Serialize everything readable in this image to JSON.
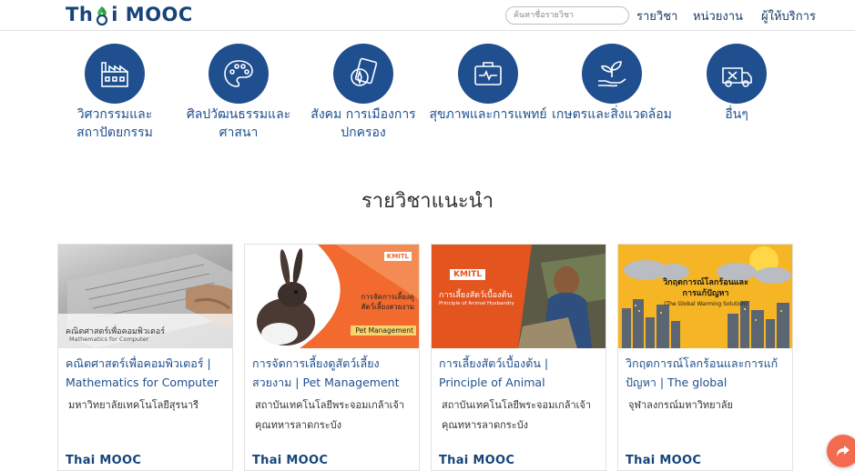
{
  "header": {
    "logo_left": "Th",
    "logo_right": "i MOOC",
    "search_placeholder": "ค้นหาชื่อรายวิชา",
    "nav": [
      "รายวิชา",
      "หน่วยงาน",
      "ผู้ให้บริการ"
    ]
  },
  "categories": [
    {
      "label": "วิศวกรรมและสถาปัตยกรรม",
      "icon": "factory-icon"
    },
    {
      "label": "ศิลปวัฒนธรรมและศาสนา",
      "icon": "palette-icon"
    },
    {
      "label": "สังคม การเมืองการปกครอง",
      "icon": "compass-icon"
    },
    {
      "label": "สุขภาพและการแพทย์",
      "icon": "medical-kit-icon"
    },
    {
      "label": "เกษตรและสิ่งแวดล้อม",
      "icon": "plant-hand-icon"
    },
    {
      "label": "อื่นๆ",
      "icon": "tools-truck-icon"
    }
  ],
  "section_title": "รายวิชาแนะนำ",
  "courses": [
    {
      "title": "คณิตศาสตร์เพื่อคอมพิวเตอร์ | Mathematics for Computer",
      "institution": "มหาวิทยาลัยเทคโนโลยีสุรนารี",
      "thumb_text_th": "คณิตศาสตร์เพื่อคอมพิวเตอร์",
      "thumb_text_en": "Mathematics for Computer"
    },
    {
      "title": "การจัดการเลี้ยงดูสัตว์เลี้ยงสวยงาม | Pet Management",
      "institution": "สถาบันเทคโนโลยีพระจอมเกล้าเจ้าคุณทหารลาดกระบัง",
      "thumb_text_th": "การจัดการเลี้ยงดูสัตว์เลี้ยงสวยงาม",
      "thumb_text_en": "Pet Management",
      "thumb_badge": "KMITL"
    },
    {
      "title": "การเลี้ยงสัตว์เบื้องต้น | Principle of Animal Husbandry",
      "institution": "สถาบันเทคโนโลยีพระจอมเกล้าเจ้าคุณทหารลาดกระบัง",
      "thumb_text_th": "การเลี้ยงสัตว์เบื้องต้น",
      "thumb_text_en": "Principle of Animal Husbandry",
      "thumb_badge": "KMITL"
    },
    {
      "title": "วิกฤตการณ์โลกร้อนและการแก้ปัญหา | The global warming...",
      "institution": "จุฬาลงกรณ์มหาวิทยาลัย",
      "thumb_text_th": "วิกฤตการณ์โลกร้อนและการแก้ปัญหา",
      "thumb_text_en": "(The Global Warming Solution)"
    }
  ],
  "footer_logo": "Thai MOOC",
  "colors": {
    "primary": "#1f4f8f",
    "logo": "#17447a",
    "share": "#f26b4f"
  }
}
